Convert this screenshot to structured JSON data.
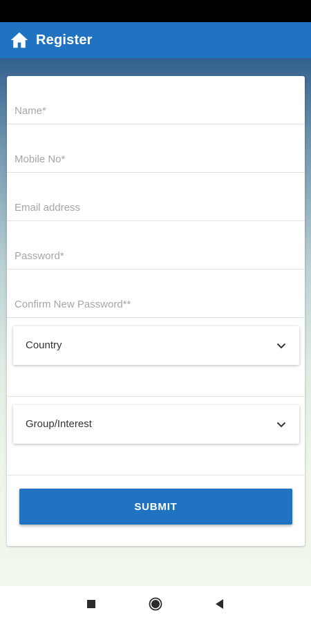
{
  "app_bar": {
    "title": "Register",
    "icon": "home-icon",
    "color": "#1f73c1"
  },
  "form": {
    "fields": [
      {
        "placeholder": "Name*"
      },
      {
        "placeholder": "Mobile No*"
      },
      {
        "placeholder": "Email address"
      },
      {
        "placeholder": "Password*"
      },
      {
        "placeholder": "Confirm New Password**"
      }
    ],
    "selects": [
      {
        "label": "Country",
        "icon": "chevron-down-icon"
      },
      {
        "label": "Group/Interest",
        "icon": "chevron-down-icon"
      }
    ],
    "submit_label": "SUBMIT"
  },
  "nav_bar": {
    "buttons": [
      "recent-apps",
      "home",
      "back"
    ]
  }
}
